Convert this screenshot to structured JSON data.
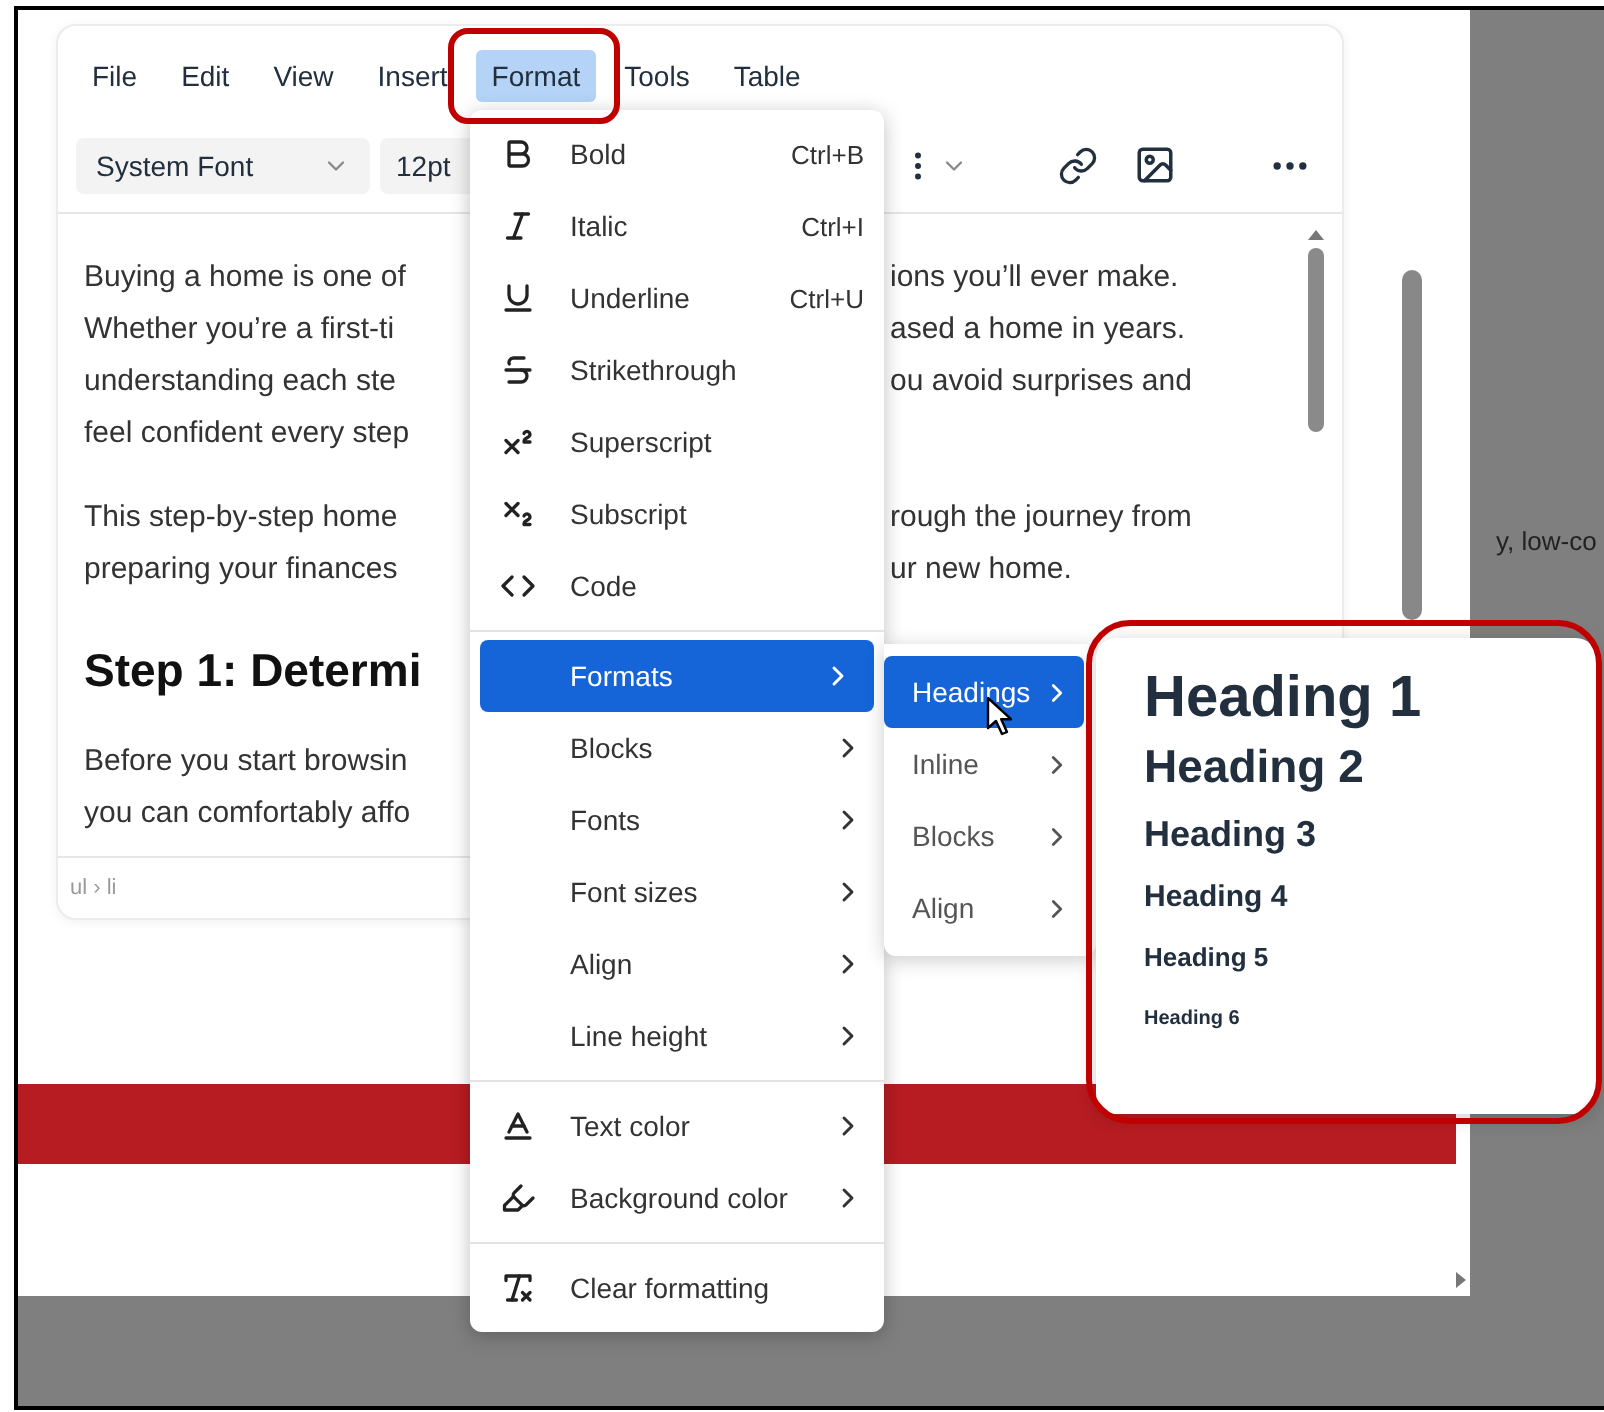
{
  "menubar": [
    {
      "label": "File",
      "selected": false
    },
    {
      "label": "Edit",
      "selected": false
    },
    {
      "label": "View",
      "selected": false
    },
    {
      "label": "Insert",
      "selected": false
    },
    {
      "label": "Format",
      "selected": true
    },
    {
      "label": "Tools",
      "selected": false
    },
    {
      "label": "Table",
      "selected": false
    }
  ],
  "toolbar": {
    "font_family": "System Font",
    "font_size": "12pt"
  },
  "document": {
    "blocks": [
      {
        "kind": "paragraph",
        "lines": [
          {
            "left": "Buying a home is one of",
            "right": "ions you’ll ever make."
          },
          {
            "left": "Whether you’re a first-ti",
            "right": "ased a home in years."
          },
          {
            "left": "understanding each ste",
            "right": "ou avoid surprises and"
          },
          {
            "left": "feel confident every step"
          }
        ]
      },
      {
        "kind": "paragraph",
        "lines": [
          {
            "left": "This step-by-step home",
            "right": "rough the journey from"
          },
          {
            "left": "preparing your finances",
            "right": "ur new home."
          }
        ]
      },
      {
        "kind": "heading",
        "lines": [
          {
            "left": "Step 1: Determi"
          }
        ]
      },
      {
        "kind": "paragraph",
        "lines": [
          {
            "left": "Before you start browsin"
          },
          {
            "left": "you can comfortably affo"
          }
        ]
      }
    ]
  },
  "status_bar": "ul › li",
  "format_menu": {
    "groups": [
      [
        {
          "label": "Bold",
          "shortcut": "Ctrl+B",
          "kind": "command",
          "selected": false
        },
        {
          "label": "Italic",
          "shortcut": "Ctrl+I",
          "kind": "command",
          "selected": false
        },
        {
          "label": "Underline",
          "shortcut": "Ctrl+U",
          "kind": "command",
          "selected": false
        },
        {
          "label": "Strikethrough",
          "kind": "command",
          "selected": false
        },
        {
          "label": "Superscript",
          "kind": "command",
          "selected": false
        },
        {
          "label": "Subscript",
          "kind": "command",
          "selected": false
        },
        {
          "label": "Code",
          "kind": "command",
          "selected": false
        }
      ],
      [
        {
          "label": "Formats",
          "kind": "submenu",
          "selected": true
        },
        {
          "label": "Blocks",
          "kind": "submenu",
          "selected": false
        },
        {
          "label": "Fonts",
          "kind": "submenu",
          "selected": false
        },
        {
          "label": "Font sizes",
          "kind": "submenu",
          "selected": false
        },
        {
          "label": "Align",
          "kind": "submenu",
          "selected": false
        },
        {
          "label": "Line height",
          "kind": "submenu",
          "selected": false
        }
      ],
      [
        {
          "label": "Text color",
          "kind": "submenu",
          "selected": false
        },
        {
          "label": "Background color",
          "kind": "submenu",
          "selected": false
        }
      ],
      [
        {
          "label": "Clear formatting",
          "kind": "command",
          "selected": false
        }
      ]
    ]
  },
  "formats_submenu": [
    {
      "label": "Headings",
      "selected": true
    },
    {
      "label": "Inline",
      "selected": false
    },
    {
      "label": "Blocks",
      "selected": false
    },
    {
      "label": "Align",
      "selected": false
    }
  ],
  "headings_submenu": [
    "Heading 1",
    "Heading 2",
    "Heading 3",
    "Heading 4",
    "Heading 5",
    "Heading 6"
  ],
  "background_text": "y, low-co"
}
